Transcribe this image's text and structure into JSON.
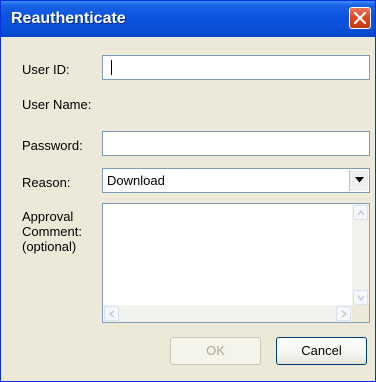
{
  "window": {
    "title": "Reauthenticate"
  },
  "form": {
    "user_id_label": "User ID:",
    "user_id_value": "",
    "user_name_label": "User Name:",
    "user_name_value": "",
    "password_label": "Password:",
    "password_value": "",
    "reason_label": "Reason:",
    "reason_value": "Download",
    "comment_label_line1": "Approval",
    "comment_label_line2": "Comment:",
    "comment_label_line3": "(optional)",
    "comment_value": ""
  },
  "buttons": {
    "ok_label": "OK",
    "ok_enabled": false,
    "cancel_label": "Cancel"
  },
  "icons": {
    "close": "close-icon",
    "dropdown": "chevron-down-icon"
  },
  "colors": {
    "title_bar": "#0a53dd",
    "close_button": "#d6451d",
    "dialog_background": "#ece9d8",
    "field_border": "#7f9db9"
  }
}
